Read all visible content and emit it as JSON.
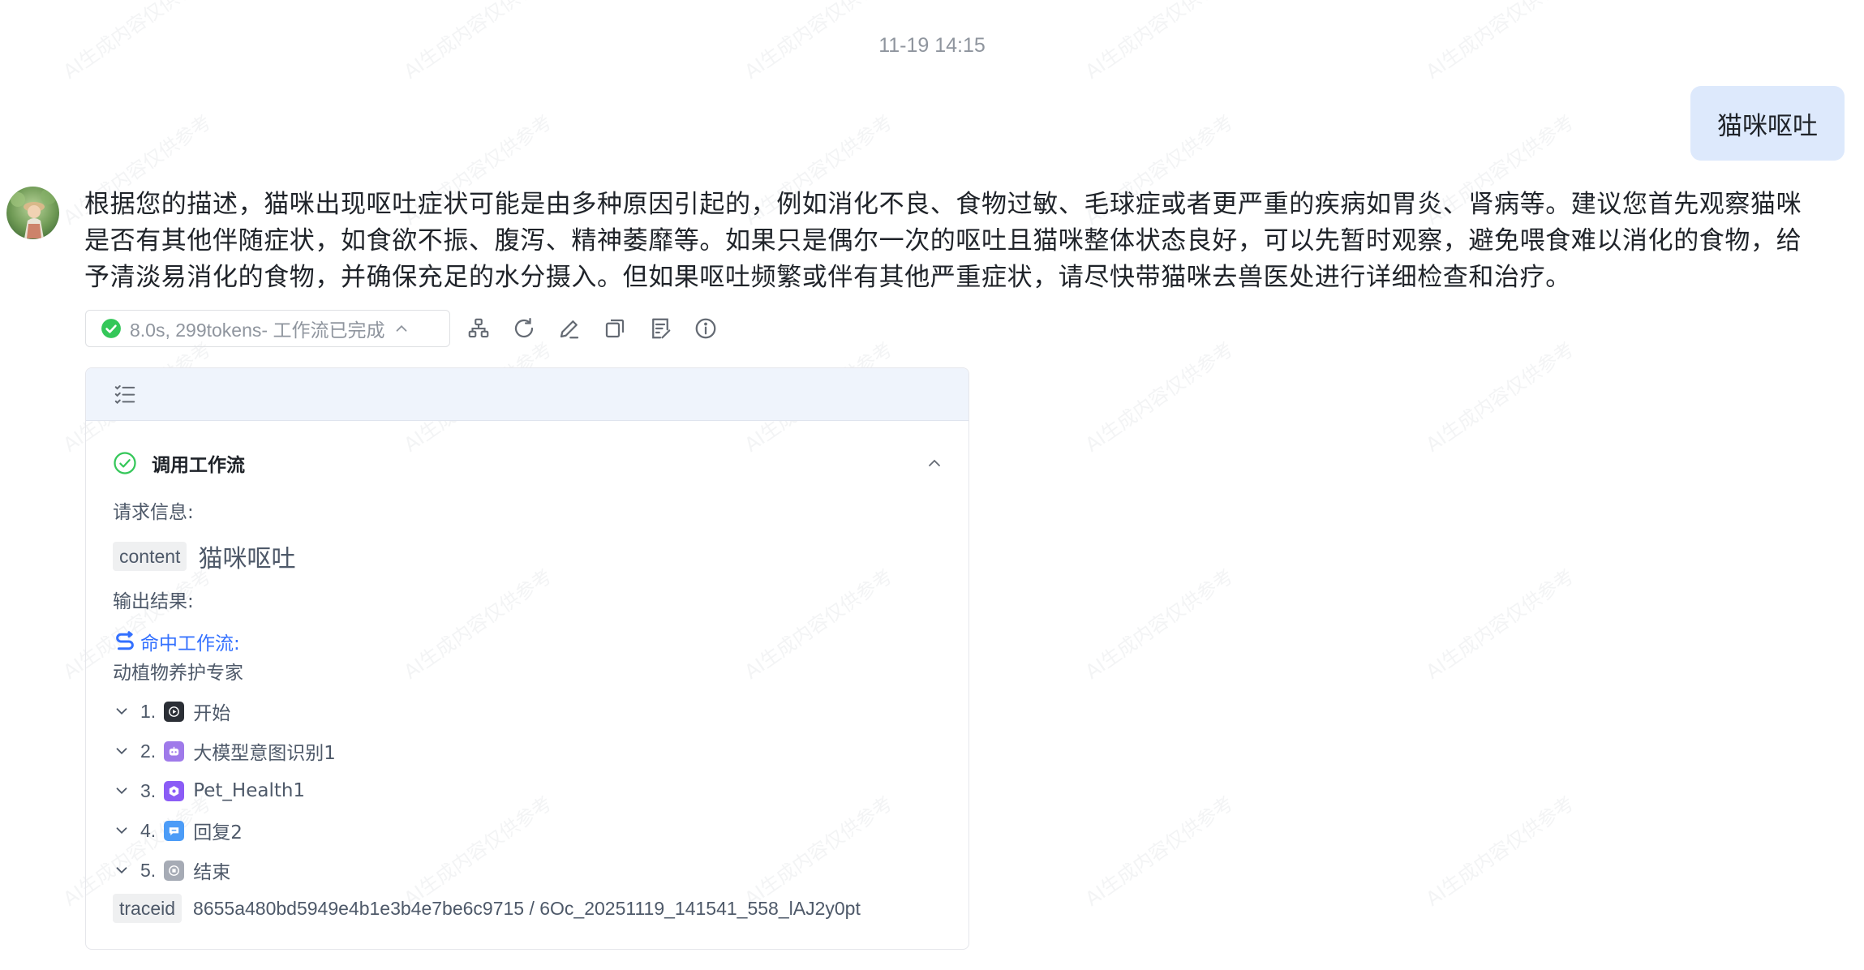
{
  "timestamp": "11-19 14:15",
  "user_message": "猫咪呕吐",
  "assistant": {
    "answer": "根据您的描述，猫咪出现呕吐症状可能是由多种原因引起的，例如消化不良、食物过敏、毛球症或者更严重的疾病如胃炎、肾病等。建议您首先观察猫咪是否有其他伴随症状，如食欲不振、腹泻、精神萎靡等。如果只是偶尔一次的呕吐且猫咪整体状态良好，可以先暂时观察，避免喂食难以消化的食物，给予清淡易消化的食物，并确保充足的水分摄入。但如果呕吐频繁或伴有其他严重症状，请尽快带猫咪去兽医处进行详细检查和治疗。",
    "status": "8.0s, 299tokens- 工作流已完成",
    "action_icons": [
      "workflow-icon",
      "refresh-icon",
      "edit-icon",
      "copy-icon",
      "notes-icon",
      "info-icon"
    ]
  },
  "panel": {
    "step_title": "调用工作流",
    "request_label": "请求信息:",
    "request_key": "content",
    "request_value": "猫咪呕吐",
    "output_label": "输出结果:",
    "hit_label": "命中工作流:",
    "workflow_name": "动植物养护专家",
    "nodes": [
      {
        "num": "1.",
        "name": "开始",
        "color": "#2b2f36"
      },
      {
        "num": "2.",
        "name": "大模型意图识别1",
        "color": "#9f7aea"
      },
      {
        "num": "3.",
        "name": "Pet_Health1",
        "color": "#8b5cf6"
      },
      {
        "num": "4.",
        "name": "回复2",
        "color": "#4c9cf7"
      },
      {
        "num": "5.",
        "name": "结束",
        "color": "#a6abb5"
      }
    ],
    "trace_key": "traceid",
    "trace_value": "8655a480bd5949e4b1e3b4e7be6c9715 / 6Oc_20251119_141541_558_lAJ2y0pt"
  },
  "watermark": "AI生成内容仅供参考",
  "colors": {
    "accent": "#3370ff",
    "success": "#34c759",
    "bubble": "#dde9fc",
    "panel_header": "#eff4fc"
  }
}
